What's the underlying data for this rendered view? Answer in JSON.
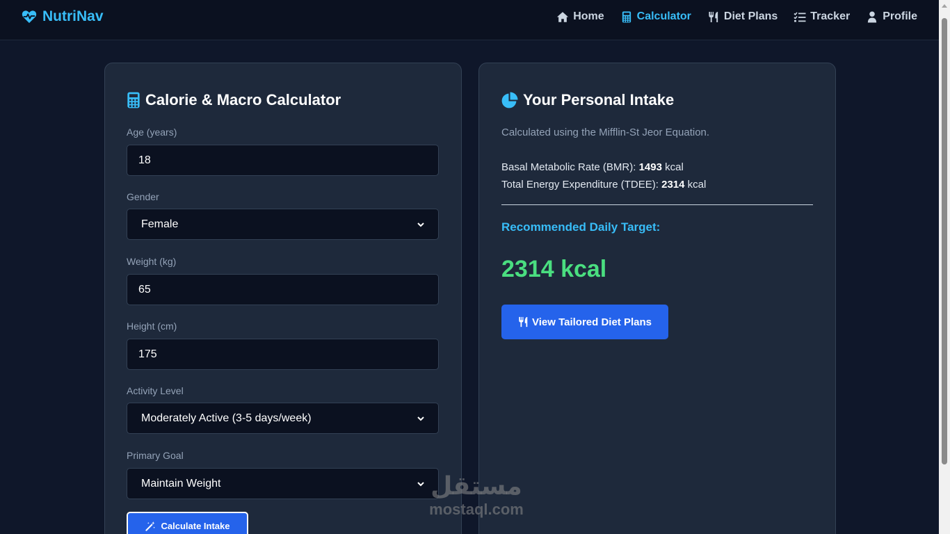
{
  "brand": {
    "name": "NutriNav",
    "icon": "heartbeat-icon",
    "color": "#38bdf8"
  },
  "nav": [
    {
      "label": "Home",
      "icon": "home-icon",
      "active": false
    },
    {
      "label": "Calculator",
      "icon": "calculator-icon",
      "active": true
    },
    {
      "label": "Diet Plans",
      "icon": "utensils-icon",
      "active": false
    },
    {
      "label": "Tracker",
      "icon": "checklist-icon",
      "active": false
    },
    {
      "label": "Profile",
      "icon": "user-icon",
      "active": false
    }
  ],
  "calculator": {
    "title": "Calorie & Macro Calculator",
    "title_icon": "calculator-icon",
    "fields": {
      "age": {
        "label": "Age (years)",
        "value": "18"
      },
      "gender": {
        "label": "Gender",
        "value": "Female"
      },
      "weight": {
        "label": "Weight (kg)",
        "value": "65"
      },
      "height": {
        "label": "Height (cm)",
        "value": "175"
      },
      "activity": {
        "label": "Activity Level",
        "value": "Moderately Active (3-5 days/week)"
      },
      "goal": {
        "label": "Primary Goal",
        "value": "Maintain Weight"
      }
    },
    "submit_label": "Calculate Intake",
    "submit_icon": "magic-wand-icon"
  },
  "intake": {
    "title": "Your Personal Intake",
    "title_icon": "pie-chart-icon",
    "subtitle": "Calculated using the Mifflin-St Jeor Equation.",
    "bmr_label": "Basal Metabolic Rate (BMR):",
    "bmr_value": "1493",
    "tdee_label": "Total Energy Expenditure (TDEE):",
    "tdee_value": "2314",
    "unit": "kcal",
    "target_label": "Recommended Daily Target:",
    "target_value": "2314 kcal",
    "cta_label": "View Tailored Diet Plans",
    "cta_icon": "utensils-icon"
  },
  "watermark": {
    "arabic": "مستقل",
    "latin": "mostaql.com"
  },
  "colors": {
    "background": "#0f172a",
    "card": "#1e293b",
    "accent": "#38bdf8",
    "button": "#2563eb",
    "target": "#4ade80"
  }
}
